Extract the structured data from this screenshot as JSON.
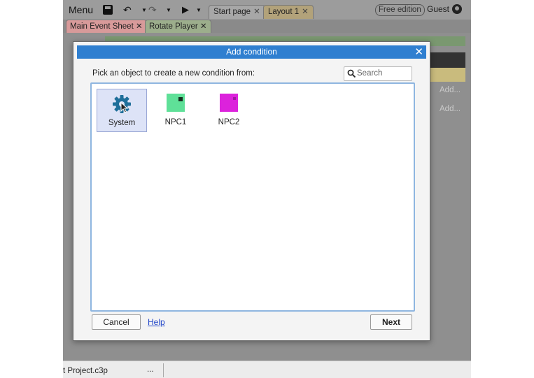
{
  "toolbar": {
    "menu_label": "Menu",
    "tabs": [
      {
        "label": "Start page",
        "close": "✕"
      },
      {
        "label": "Layout 1",
        "close": "✕"
      }
    ],
    "edition_badge": "Free edition",
    "user": "Guest"
  },
  "sheet_tabs": [
    {
      "label": "Main Event Sheet",
      "close": "✕"
    },
    {
      "label": "Rotate Player",
      "close": "✕"
    }
  ],
  "background": {
    "add_1": "Add...",
    "add_2": "Add..."
  },
  "status_bar": {
    "project": "t Project.c3p",
    "more": "..."
  },
  "dialog": {
    "title": "Add condition",
    "close": "✕",
    "prompt": "Pick an object to create a new condition from:",
    "search_placeholder": "Search",
    "objects": [
      {
        "name": "System",
        "icon": "gear-icon",
        "color": "#1f6f9a",
        "selected": true
      },
      {
        "name": "NPC1",
        "icon": "sprite-icon",
        "color": "#5fe098",
        "selected": false
      },
      {
        "name": "NPC2",
        "icon": "sprite-icon",
        "color": "#dc22dc",
        "selected": false
      }
    ],
    "cancel_label": "Cancel",
    "help_label": "Help",
    "next_label": "Next"
  },
  "colors": {
    "title_bar": "#2f7fd0",
    "list_border": "#8fb6e0",
    "link": "#2146c8"
  }
}
